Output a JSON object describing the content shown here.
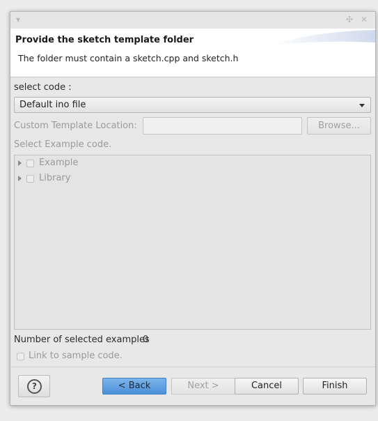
{
  "banner": {
    "title": "Provide the sketch template folder",
    "message": "The folder must contain a sketch.cpp and sketch.h"
  },
  "form": {
    "select_code_label": "select code :",
    "select_code_value": "Default ino file",
    "custom_template_label": "Custom Template Location:",
    "custom_template_value": "",
    "browse_label": "Browse...",
    "select_example_label": "Select Example code.",
    "tree_items": [
      {
        "label": "Example"
      },
      {
        "label": "Library"
      }
    ],
    "selected_count_label": "Number of selected examples",
    "selected_count_value": "0",
    "link_label": "Link to sample code."
  },
  "footer": {
    "help_icon": "question-mark-icon",
    "help_glyph": "?",
    "back_label": "< Back",
    "next_label": "Next >",
    "cancel_label": "Cancel",
    "finish_label": "Finish"
  },
  "colors": {
    "primary_button": "#5a9ee0",
    "disabled_text": "#9a9a9a"
  }
}
